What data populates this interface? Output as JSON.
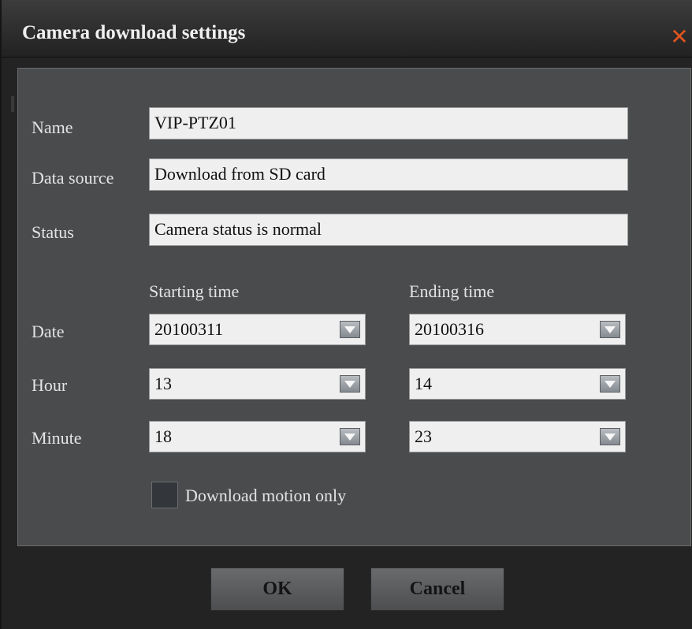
{
  "window": {
    "title": "Camera download settings",
    "close_glyph": "✕"
  },
  "form": {
    "name_label": "Name",
    "name_value": "VIP-PTZ01",
    "source_label": "Data source",
    "source_value": "Download from SD card",
    "status_label": "Status",
    "status_value": "Camera status is normal",
    "start_header": "Starting time",
    "end_header": "Ending time",
    "date_label": "Date",
    "hour_label": "Hour",
    "minute_label": "Minute",
    "start_date": "20100311",
    "end_date": "20100316",
    "start_hour": "13",
    "end_hour": "14",
    "start_minute": "18",
    "end_minute": "23",
    "motion_label": "Download motion only",
    "motion_checked": false
  },
  "buttons": {
    "ok": "OK",
    "cancel": "Cancel"
  },
  "colors": {
    "accent_close": "#e0541e",
    "panel": "#4a4b4d",
    "background": "#232323"
  },
  "icons": {
    "close": "close-icon",
    "dropdown": "chevron-down-icon"
  }
}
